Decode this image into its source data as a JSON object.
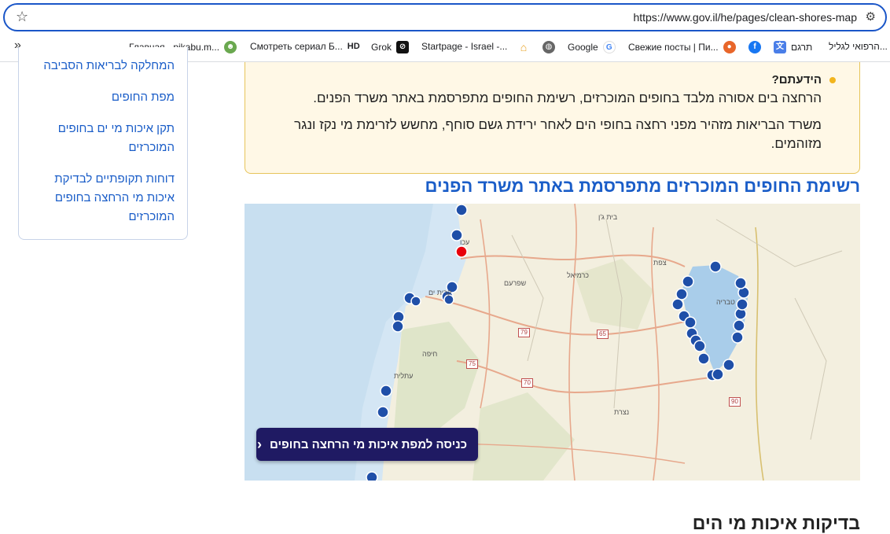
{
  "browser": {
    "url": "https://www.gov.il/he/pages/clean-shores-map",
    "bookmarks": [
      {
        "label": "הרפואי לגליל...",
        "icon": "generic-site-icon",
        "color": "#555555"
      },
      {
        "label": "תרגם",
        "icon": "translate-icon",
        "color": "#4a7ee8"
      },
      {
        "label": "",
        "icon": "facebook-icon",
        "color": "#1877f2"
      },
      {
        "label": "Свежие посты | Пи...",
        "icon": "pikabu-icon",
        "color": "#e8662a"
      },
      {
        "label": "Google",
        "icon": "google-icon",
        "color": "#4285f4"
      },
      {
        "label": "",
        "icon": "globe-icon",
        "color": "#555555"
      },
      {
        "label": "",
        "icon": "home-icon",
        "color": "#e8a020"
      },
      {
        "label": "Startpage - Israel -...",
        "icon": "startpage-icon",
        "color": "#6573ff"
      },
      {
        "label": "Grok",
        "icon": "grok-icon",
        "color": "#111111"
      },
      {
        "label": "Смотреть сериал Б...",
        "icon": "hd-icon",
        "color": "#111111"
      },
      {
        "label": "Главная - pikabu.m...",
        "icon": "pikabu-mascot-icon",
        "color": "#6aa84f"
      }
    ],
    "hd_label": "HD"
  },
  "sidebar": {
    "items": [
      {
        "label": "המחלקה לבריאות הסביבה"
      },
      {
        "label": "מפת החופים"
      },
      {
        "label": "תקן איכות מי ים בחופים המוכרזים"
      },
      {
        "label": "דוחות תקופתיים לבדיקת איכות מי הרחצה בחופים המוכרזים"
      }
    ]
  },
  "info": {
    "title": "הידעתם?",
    "p1": "הרחצה בים אסורה מלבד בחופים המוכרזים, רשימת החופים מתפרסמת באתר משרד הפנים.",
    "p2": "משרד הבריאות מזהיר מפני רחצה בחופי הים לאחר ירידת גשם סוחף, מחשש לזרימת מי נקז ונגר מזוהמים.",
    "accent": "#f2b51e"
  },
  "map_section": {
    "heading": "רשימת החופים המוכרזים מתפרסמת באתר משרד הפנים",
    "button_label": "כניסה למפת איכות מי הרחצה בחופים",
    "town_labels": [
      "עכו",
      "כרמיאל",
      "צפת",
      "טבריה",
      "קרית ים",
      "חיפה",
      "עתלית",
      "בית ג'ן",
      "שפרעם",
      "נצרת"
    ],
    "route_labels": [
      "79",
      "65",
      "75",
      "70",
      "90"
    ],
    "marker_color": "#1f4fa8",
    "highlight_color": "#e8000b"
  },
  "section2": {
    "title": "בדיקות איכות מי הים"
  }
}
